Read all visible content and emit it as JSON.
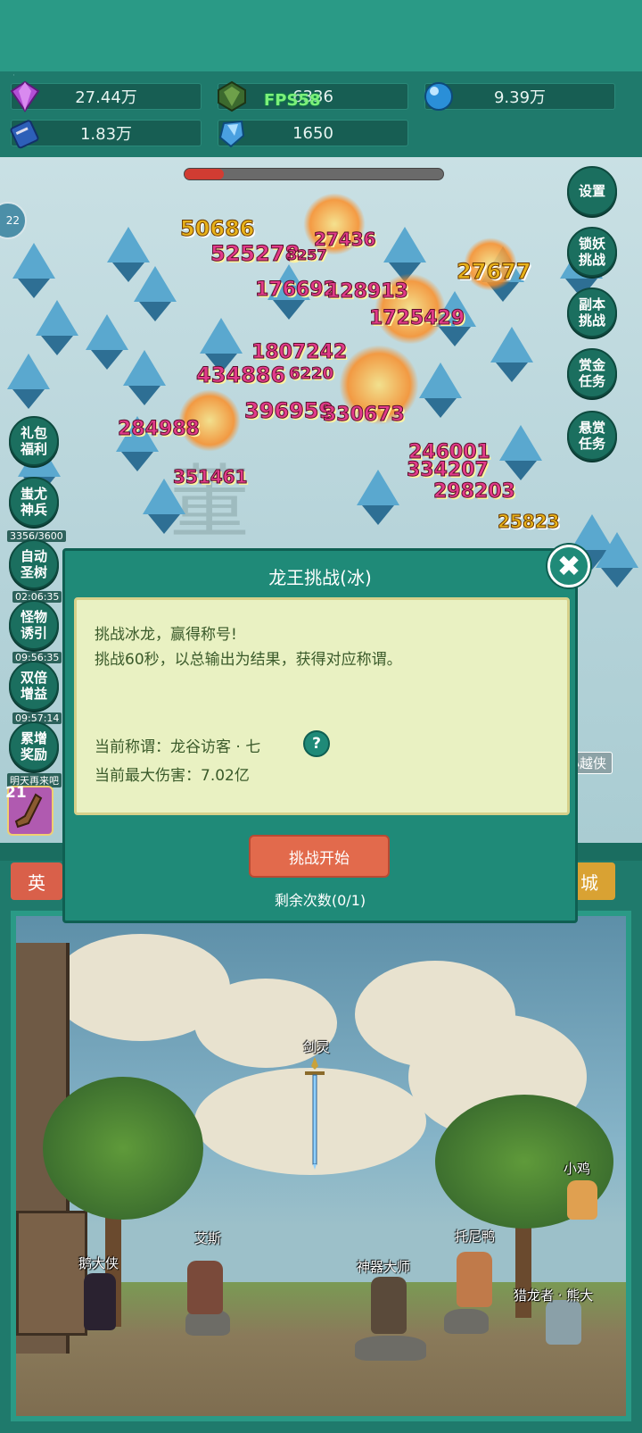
{
  "resources": {
    "gem": "27.44万",
    "emerald": "6336",
    "orb": "9.39万",
    "book": "1.83万",
    "crystal": "1650"
  },
  "fps": "FPS58",
  "boss_hp_fraction": 0.15,
  "round_badge": "22",
  "damage_numbers": [
    "50686",
    "525278",
    "3257",
    "27436",
    "27677",
    "176692",
    "128913",
    "1725429",
    "1807242",
    "434886",
    "6220",
    "396959",
    "330673",
    "284988",
    "246001",
    "334207",
    "351461",
    "298203",
    "25823"
  ],
  "watermark": "董",
  "side_right": {
    "settings": "设置",
    "lock_demon": "锁妖挑战",
    "dungeon": "副本挑战",
    "bounty": "赏金任务",
    "reward": "悬赏任务"
  },
  "side_left": {
    "gift": "礼包福利",
    "weapon": "蚩尤神兵",
    "weapon_progress": "3356/3600",
    "auto_tree": "自动圣树",
    "auto_tree_timer": "02:06:35",
    "lure": "怪物诱引",
    "lure_timer": "09:56:35",
    "double": "双倍增益",
    "double_timer": "09:57:14",
    "accumulate": "累增奖励",
    "accumulate_note": "明天再来吧"
  },
  "hero_tag": "小越侠",
  "level_badge": "21",
  "tabs": {
    "left": "英",
    "right": "城"
  },
  "dialog": {
    "title": "龙王挑战(冰)",
    "line1": "挑战冰龙，赢得称号!",
    "line2": "挑战60秒，以总输出为结果，获得对应称谓。",
    "current_title": "当前称谓：龙谷访客 · 七",
    "max_damage": "当前最大伤害：7.02亿",
    "help": "?",
    "start": "挑战开始",
    "remaining": "剩余次数(0/1)",
    "close": "✖"
  },
  "npcs": {
    "sword": "剑灵",
    "goose": "鹅大侠",
    "aisi": "艾斯",
    "master": "神器大师",
    "duck": "托尼鸭",
    "chick": "小鸡",
    "bear": "猎龙者 · 熊大"
  },
  "colors": {
    "panel": "#1f8a78",
    "accent_button": "#e26a4c",
    "damage_pink": "#e23b8a"
  }
}
